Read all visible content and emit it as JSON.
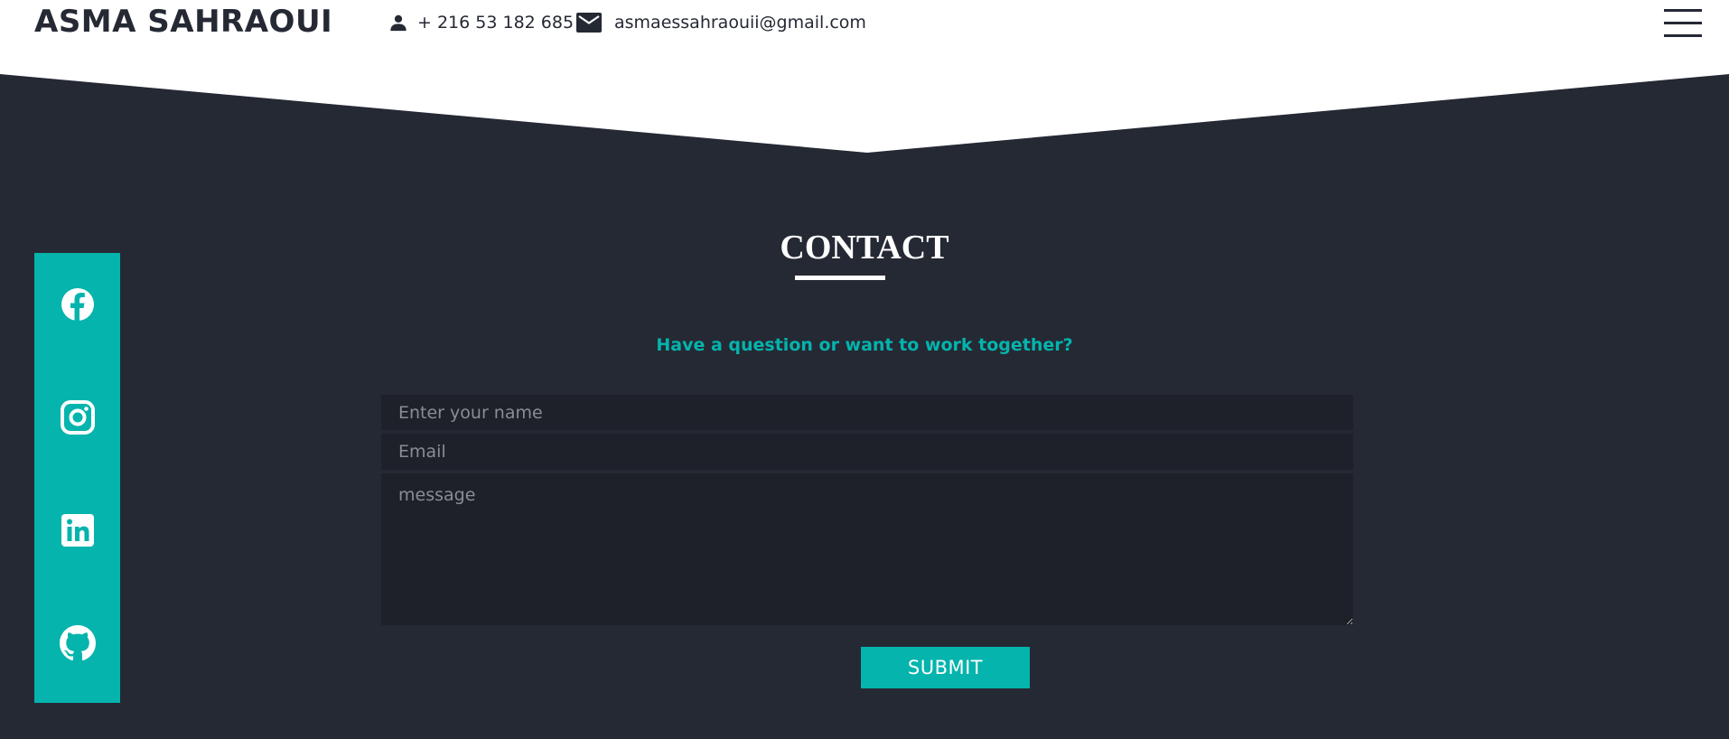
{
  "header": {
    "brand": "ASMA SAHRAOUI",
    "phone": "+ 216 53 182 685",
    "email": "asmaessahraouii@gmail.com"
  },
  "contact": {
    "title": "CONTACT",
    "subtitle": "Have a question or want to work together?",
    "name_placeholder": "Enter your name",
    "email_placeholder": "Email",
    "message_placeholder": "message",
    "submit_label": "SUBMIT"
  },
  "social": {
    "icons": [
      "facebook-icon",
      "instagram-icon",
      "linkedin-icon",
      "github-icon"
    ]
  },
  "colors": {
    "accent": "#04b4ad",
    "background": "#252934",
    "field_background": "#1e2129",
    "header_background": "#ffffff"
  }
}
